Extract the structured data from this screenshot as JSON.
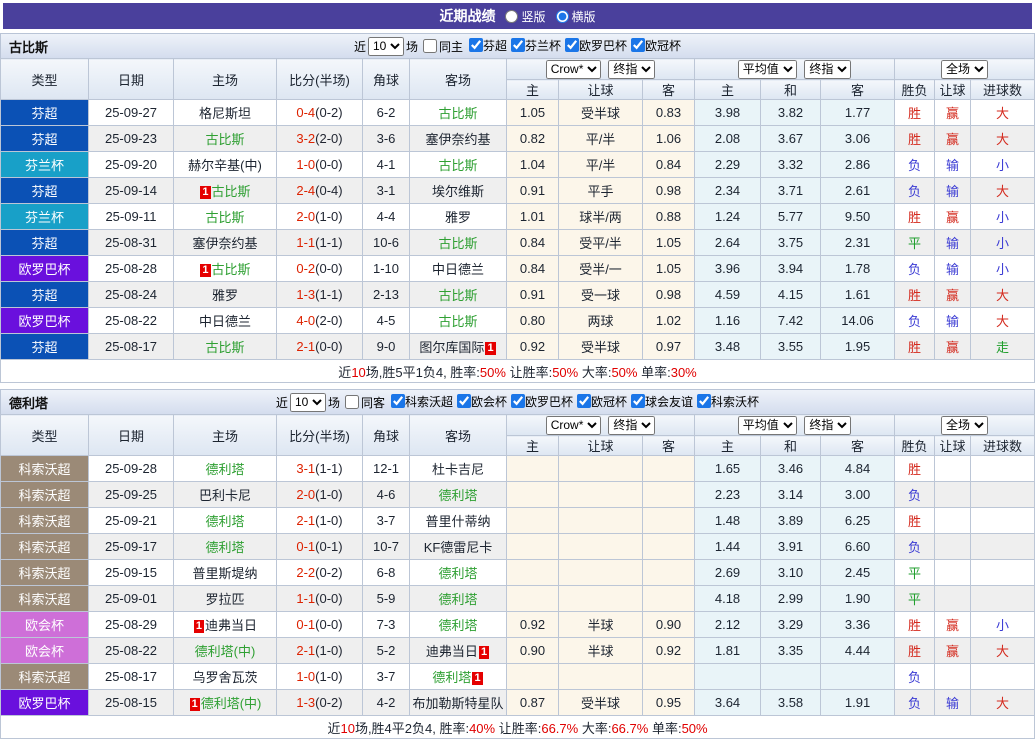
{
  "title_bar": {
    "title": "近期战绩",
    "options": [
      "竖版",
      "横版"
    ],
    "selected": "横版"
  },
  "type_colors": {
    "芬超": "#0b51b5",
    "芬兰杯": "#18a0c8",
    "欧罗巴杯": "#6a10dd",
    "科索沃超": "#9b8a77",
    "欧会杯": "#ce6fd8"
  },
  "header": {
    "cols": [
      "类型",
      "日期",
      "主场",
      "比分(半场)",
      "角球",
      "客场"
    ],
    "sub": [
      "主",
      "让球",
      "客",
      "主",
      "和",
      "客",
      "胜负",
      "让球",
      "进球数"
    ],
    "selects": {
      "bookmaker": "Crow*",
      "bookmaker_final": "终指",
      "avg": "平均值",
      "avg_final": "终指",
      "period": "全场"
    }
  },
  "tables": [
    {
      "team": "古比斯",
      "filter": {
        "near": "近",
        "count": "10",
        "unit": "场",
        "same": "同主",
        "leagues": [
          "芬超",
          "芬兰杯",
          "欧罗巴杯",
          "欧冠杯"
        ]
      },
      "rows": [
        {
          "type": "芬超",
          "date": "25-09-27",
          "home": {
            "t": "格尼斯坦"
          },
          "score": "0-4",
          "half": "0-2",
          "corner": "6-2",
          "away": {
            "t": "古比斯",
            "g": 1
          },
          "odds": [
            "1.05",
            "受半球",
            "0.83"
          ],
          "avg": [
            "3.98",
            "3.82",
            "1.77"
          ],
          "res": [
            [
              "胜",
              "w"
            ],
            [
              "赢",
              "w"
            ],
            [
              "大",
              "w"
            ]
          ]
        },
        {
          "type": "芬超",
          "date": "25-09-23",
          "home": {
            "t": "古比斯",
            "g": 1
          },
          "score": "3-2",
          "half": "2-0",
          "corner": "3-6",
          "away": {
            "t": "塞伊奈约基"
          },
          "odds": [
            "0.82",
            "平/半",
            "1.06"
          ],
          "avg": [
            "2.08",
            "3.67",
            "3.06"
          ],
          "res": [
            [
              "胜",
              "w"
            ],
            [
              "赢",
              "w"
            ],
            [
              "大",
              "w"
            ]
          ]
        },
        {
          "type": "芬兰杯",
          "date": "25-09-20",
          "home": {
            "t": "赫尔辛基(中)"
          },
          "score": "1-0",
          "half": "0-0",
          "corner": "4-1",
          "away": {
            "t": "古比斯",
            "g": 1
          },
          "odds": [
            "1.04",
            "平/半",
            "0.84"
          ],
          "avg": [
            "2.29",
            "3.32",
            "2.86"
          ],
          "res": [
            [
              "负",
              "l"
            ],
            [
              "输",
              "l"
            ],
            [
              "小",
              "l"
            ]
          ]
        },
        {
          "type": "芬超",
          "date": "25-09-14",
          "home": {
            "t": "古比斯",
            "g": 1,
            "b1": 1
          },
          "score": "2-4",
          "half": "0-4",
          "corner": "3-1",
          "away": {
            "t": "埃尔维斯"
          },
          "odds": [
            "0.91",
            "平手",
            "0.98"
          ],
          "avg": [
            "2.34",
            "3.71",
            "2.61"
          ],
          "res": [
            [
              "负",
              "l"
            ],
            [
              "输",
              "l"
            ],
            [
              "大",
              "w"
            ]
          ]
        },
        {
          "type": "芬兰杯",
          "date": "25-09-11",
          "home": {
            "t": "古比斯",
            "g": 1
          },
          "score": "2-0",
          "half": "1-0",
          "corner": "4-4",
          "away": {
            "t": "雅罗"
          },
          "odds": [
            "1.01",
            "球半/两",
            "0.88"
          ],
          "avg": [
            "1.24",
            "5.77",
            "9.50"
          ],
          "res": [
            [
              "胜",
              "w"
            ],
            [
              "赢",
              "w"
            ],
            [
              "小",
              "l"
            ]
          ]
        },
        {
          "type": "芬超",
          "date": "25-08-31",
          "home": {
            "t": "塞伊奈约基"
          },
          "score": "1-1",
          "half": "1-1",
          "corner": "10-6",
          "away": {
            "t": "古比斯",
            "g": 1
          },
          "odds": [
            "0.84",
            "受平/半",
            "1.05"
          ],
          "avg": [
            "2.64",
            "3.75",
            "2.31"
          ],
          "res": [
            [
              "平",
              "d"
            ],
            [
              "输",
              "l"
            ],
            [
              "小",
              "l"
            ]
          ]
        },
        {
          "type": "欧罗巴杯",
          "date": "25-08-28",
          "home": {
            "t": "古比斯",
            "g": 1,
            "b1": 1
          },
          "score": "0-2",
          "half": "0-0",
          "corner": "1-10",
          "away": {
            "t": "中日德兰"
          },
          "odds": [
            "0.84",
            "受半/一",
            "1.05"
          ],
          "avg": [
            "3.96",
            "3.94",
            "1.78"
          ],
          "res": [
            [
              "负",
              "l"
            ],
            [
              "输",
              "l"
            ],
            [
              "小",
              "l"
            ]
          ]
        },
        {
          "type": "芬超",
          "date": "25-08-24",
          "home": {
            "t": "雅罗"
          },
          "score": "1-3",
          "half": "1-1",
          "corner": "2-13",
          "away": {
            "t": "古比斯",
            "g": 1
          },
          "odds": [
            "0.91",
            "受一球",
            "0.98"
          ],
          "avg": [
            "4.59",
            "4.15",
            "1.61"
          ],
          "res": [
            [
              "胜",
              "w"
            ],
            [
              "赢",
              "w"
            ],
            [
              "大",
              "w"
            ]
          ]
        },
        {
          "type": "欧罗巴杯",
          "date": "25-08-22",
          "home": {
            "t": "中日德兰"
          },
          "score": "4-0",
          "half": "2-0",
          "corner": "4-5",
          "away": {
            "t": "古比斯",
            "g": 1
          },
          "odds": [
            "0.80",
            "两球",
            "1.02"
          ],
          "avg": [
            "1.16",
            "7.42",
            "14.06"
          ],
          "res": [
            [
              "负",
              "l"
            ],
            [
              "输",
              "l"
            ],
            [
              "大",
              "w"
            ]
          ]
        },
        {
          "type": "芬超",
          "date": "25-08-17",
          "home": {
            "t": "古比斯",
            "g": 1
          },
          "score": "2-1",
          "half": "0-0",
          "corner": "9-0",
          "away": {
            "t": "图尔库国际",
            "b2": 1
          },
          "odds": [
            "0.92",
            "受半球",
            "0.97"
          ],
          "avg": [
            "3.48",
            "3.55",
            "1.95"
          ],
          "res": [
            [
              "胜",
              "w"
            ],
            [
              "赢",
              "w"
            ],
            [
              "走",
              "d"
            ]
          ]
        }
      ],
      "summary": [
        [
          "近",
          "k"
        ],
        [
          "10",
          "r"
        ],
        [
          "场,胜5平1负4, 胜率:",
          "k"
        ],
        [
          "50%",
          "r"
        ],
        [
          " 让胜率:",
          "k"
        ],
        [
          "50%",
          "r"
        ],
        [
          " 大率:",
          "k"
        ],
        [
          "50%",
          "r"
        ],
        [
          " 单率:",
          "k"
        ],
        [
          "30%",
          "r"
        ]
      ]
    },
    {
      "team": "德利塔",
      "filter": {
        "near": "近",
        "count": "10",
        "unit": "场",
        "same": "同客",
        "leagues": [
          "科索沃超",
          "欧会杯",
          "欧罗巴杯",
          "欧冠杯",
          "球会友谊",
          "科索沃杯"
        ]
      },
      "rows": [
        {
          "type": "科索沃超",
          "date": "25-09-28",
          "home": {
            "t": "德利塔",
            "g": 1
          },
          "score": "3-1",
          "half": "1-1",
          "corner": "12-1",
          "away": {
            "t": "杜卡吉尼"
          },
          "odds": [
            "",
            "",
            ""
          ],
          "avg": [
            "1.65",
            "3.46",
            "4.84"
          ],
          "res": [
            [
              "胜",
              "w"
            ],
            [
              "",
              ""
            ],
            [
              "",
              ""
            ]
          ]
        },
        {
          "type": "科索沃超",
          "date": "25-09-25",
          "home": {
            "t": "巴利卡尼"
          },
          "score": "2-0",
          "half": "1-0",
          "corner": "4-6",
          "away": {
            "t": "德利塔",
            "g": 1
          },
          "odds": [
            "",
            "",
            ""
          ],
          "avg": [
            "2.23",
            "3.14",
            "3.00"
          ],
          "res": [
            [
              "负",
              "l"
            ],
            [
              "",
              ""
            ],
            [
              "",
              ""
            ]
          ]
        },
        {
          "type": "科索沃超",
          "date": "25-09-21",
          "home": {
            "t": "德利塔",
            "g": 1
          },
          "score": "2-1",
          "half": "1-0",
          "corner": "3-7",
          "away": {
            "t": "普里什蒂纳"
          },
          "odds": [
            "",
            "",
            ""
          ],
          "avg": [
            "1.48",
            "3.89",
            "6.25"
          ],
          "res": [
            [
              "胜",
              "w"
            ],
            [
              "",
              ""
            ],
            [
              "",
              ""
            ]
          ]
        },
        {
          "type": "科索沃超",
          "date": "25-09-17",
          "home": {
            "t": "德利塔",
            "g": 1
          },
          "score": "0-1",
          "half": "0-1",
          "corner": "10-7",
          "away": {
            "t": "KF德雷尼卡"
          },
          "odds": [
            "",
            "",
            ""
          ],
          "avg": [
            "1.44",
            "3.91",
            "6.60"
          ],
          "res": [
            [
              "负",
              "l"
            ],
            [
              "",
              ""
            ],
            [
              "",
              ""
            ]
          ]
        },
        {
          "type": "科索沃超",
          "date": "25-09-15",
          "home": {
            "t": "普里斯堤纳"
          },
          "score": "2-2",
          "half": "0-2",
          "corner": "6-8",
          "away": {
            "t": "德利塔",
            "g": 1
          },
          "odds": [
            "",
            "",
            ""
          ],
          "avg": [
            "2.69",
            "3.10",
            "2.45"
          ],
          "res": [
            [
              "平",
              "d"
            ],
            [
              "",
              ""
            ],
            [
              "",
              ""
            ]
          ]
        },
        {
          "type": "科索沃超",
          "date": "25-09-01",
          "home": {
            "t": "罗拉匹"
          },
          "score": "1-1",
          "half": "0-0",
          "corner": "5-9",
          "away": {
            "t": "德利塔",
            "g": 1
          },
          "odds": [
            "",
            "",
            ""
          ],
          "avg": [
            "4.18",
            "2.99",
            "1.90"
          ],
          "res": [
            [
              "平",
              "d"
            ],
            [
              "",
              ""
            ],
            [
              "",
              ""
            ]
          ]
        },
        {
          "type": "欧会杯",
          "date": "25-08-29",
          "home": {
            "t": "迪弗当日",
            "b1": 1
          },
          "score": "0-1",
          "half": "0-0",
          "corner": "7-3",
          "away": {
            "t": "德利塔",
            "g": 1
          },
          "odds": [
            "0.92",
            "半球",
            "0.90"
          ],
          "avg": [
            "2.12",
            "3.29",
            "3.36"
          ],
          "res": [
            [
              "胜",
              "w"
            ],
            [
              "赢",
              "w"
            ],
            [
              "小",
              "l"
            ]
          ]
        },
        {
          "type": "欧会杯",
          "date": "25-08-22",
          "home": {
            "t": "德利塔(中)",
            "g": 1
          },
          "score": "2-1",
          "half": "1-0",
          "corner": "5-2",
          "away": {
            "t": "迪弗当日",
            "b2": 1
          },
          "odds": [
            "0.90",
            "半球",
            "0.92"
          ],
          "avg": [
            "1.81",
            "3.35",
            "4.44"
          ],
          "res": [
            [
              "胜",
              "w"
            ],
            [
              "赢",
              "w"
            ],
            [
              "大",
              "w"
            ]
          ]
        },
        {
          "type": "科索沃超",
          "date": "25-08-17",
          "home": {
            "t": "乌罗舍瓦茨"
          },
          "score": "1-0",
          "half": "1-0",
          "corner": "3-7",
          "away": {
            "t": "德利塔",
            "g": 1,
            "b2": 1
          },
          "odds": [
            "",
            "",
            ""
          ],
          "avg": [
            "",
            "",
            ""
          ],
          "res": [
            [
              "负",
              "l"
            ],
            [
              "",
              ""
            ],
            [
              "",
              ""
            ]
          ]
        },
        {
          "type": "欧罗巴杯",
          "date": "25-08-15",
          "home": {
            "t": "德利塔(中)",
            "g": 1,
            "b1": 1
          },
          "score": "1-3",
          "half": "0-2",
          "corner": "4-2",
          "away": {
            "t": "布加勒斯特星队"
          },
          "odds": [
            "0.87",
            "受半球",
            "0.95"
          ],
          "avg": [
            "3.64",
            "3.58",
            "1.91"
          ],
          "res": [
            [
              "负",
              "l"
            ],
            [
              "输",
              "l"
            ],
            [
              "大",
              "w"
            ]
          ]
        }
      ],
      "summary": [
        [
          "近",
          "k"
        ],
        [
          "10",
          "r"
        ],
        [
          "场,胜4平2负4, 胜率:",
          "k"
        ],
        [
          "40%",
          "r"
        ],
        [
          " 让胜率:",
          "k"
        ],
        [
          "66.7%",
          "r"
        ],
        [
          " 大率:",
          "k"
        ],
        [
          "66.7%",
          "r"
        ],
        [
          " 单率:",
          "k"
        ],
        [
          "50%",
          "r"
        ]
      ]
    }
  ]
}
